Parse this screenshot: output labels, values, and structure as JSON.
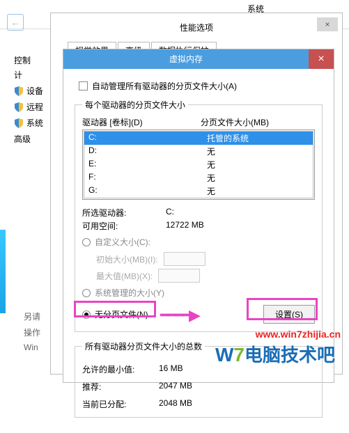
{
  "bg": {
    "title": "系统",
    "back_glyph": "←",
    "cp": "控制",
    "plan": "计",
    "items": [
      "设备",
      "远程",
      "系统",
      "高级"
    ]
  },
  "perf": {
    "title": "性能选项",
    "close": "×",
    "tabs": [
      "视觉效果",
      "高级",
      "数据执行保护"
    ]
  },
  "vm": {
    "title": "虚拟内存",
    "close": "×",
    "auto_cb": "自动管理所有驱动器的分页文件大小(A)",
    "group1": "每个驱动器的分页文件大小",
    "col_drive": "驱动器 [卷标](D)",
    "col_size": "分页文件大小(MB)",
    "drives": [
      {
        "d": "C:",
        "v": "托管的系统",
        "sel": true
      },
      {
        "d": "D:",
        "v": "无"
      },
      {
        "d": "E:",
        "v": "无"
      },
      {
        "d": "F:",
        "v": "无"
      },
      {
        "d": "G:",
        "v": "无"
      }
    ],
    "selected_drive_k": "所选驱动器:",
    "selected_drive_v": "C:",
    "free_k": "可用空间:",
    "free_v": "12722 MB",
    "custom": "自定义大小(C):",
    "init_k": "初始大小(MB)(I):",
    "max_k": "最大值(MB)(X):",
    "sys_managed": "系统管理的大小(Y)",
    "no_page": "无分页文件(N)",
    "set_btn": "设置(S)",
    "totals_legend": "所有驱动器分页文件大小的总数",
    "min_k": "允许的最小值:",
    "min_v": "16 MB",
    "rec_k": "推荐:",
    "rec_v": "2047 MB",
    "cur_k": "当前已分配:",
    "cur_v": "2048 MB"
  },
  "side": {
    "other": "另请",
    "op": "操作",
    "win": "Win"
  },
  "wm": {
    "url": "www.win7zhijia.cn",
    "w": "W",
    "n": "7",
    "txt": "电脑技术吧"
  }
}
